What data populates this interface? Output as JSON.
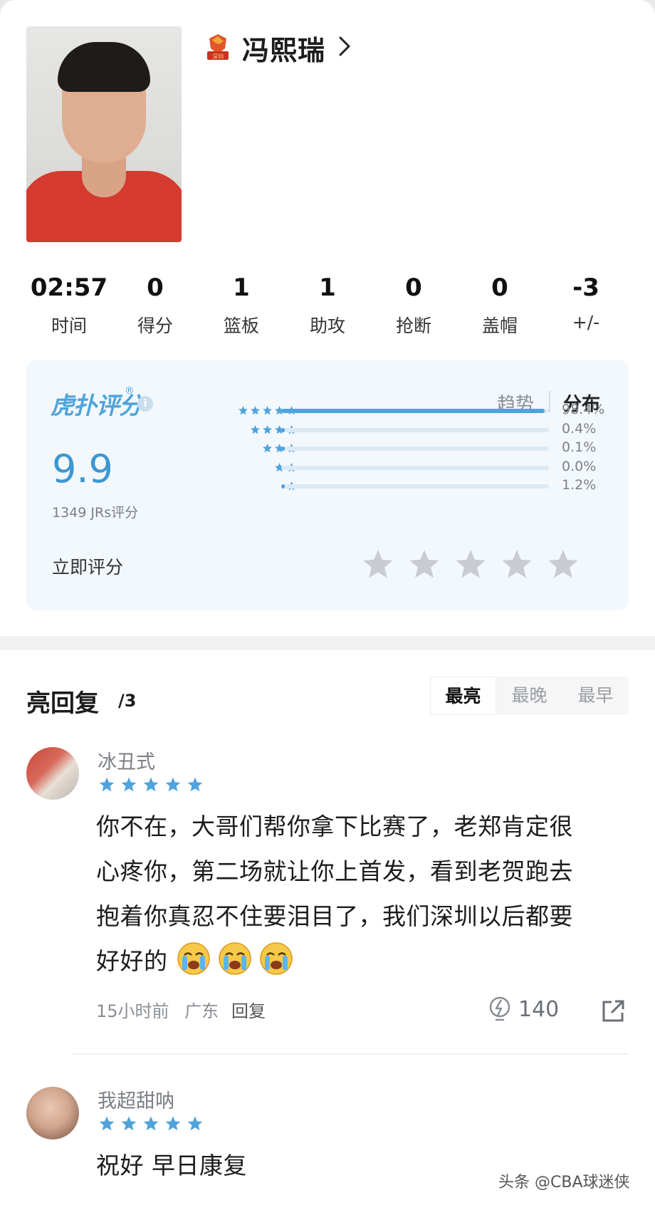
{
  "player": {
    "name": "冯熙瑞",
    "team_logo_text": "深圳"
  },
  "stats": [
    {
      "value": "02:57",
      "label": "时间"
    },
    {
      "value": "0",
      "label": "得分"
    },
    {
      "value": "1",
      "label": "篮板"
    },
    {
      "value": "1",
      "label": "助攻"
    },
    {
      "value": "0",
      "label": "抢断"
    },
    {
      "value": "0",
      "label": "盖帽"
    },
    {
      "value": "-3",
      "label": "+/-"
    }
  ],
  "rating": {
    "brand": "虎扑评分",
    "brand_mark": "®",
    "info_symbol": "i",
    "tabs": {
      "trend": "趋势",
      "distribution": "分布"
    },
    "score": "9.9",
    "votes": "1349 JRs评分",
    "distribution": [
      {
        "stars": 5,
        "percent": "98.4%",
        "fraction": 0.984
      },
      {
        "stars": 4,
        "percent": "0.4%",
        "fraction": 0.004
      },
      {
        "stars": 3,
        "percent": "0.1%",
        "fraction": 0.001
      },
      {
        "stars": 2,
        "percent": "0.0%",
        "fraction": 0.0
      },
      {
        "stars": 1,
        "percent": "1.2%",
        "fraction": 0.012
      }
    ],
    "rate_now": "立即评分",
    "accent": "#4ea3dc"
  },
  "replies": {
    "title": "亮回复",
    "count": "/3",
    "sort_tabs": [
      "最亮",
      "最晚",
      "最早"
    ],
    "active_sort": "最亮"
  },
  "comments": [
    {
      "username": "冰丑式",
      "stars": 5,
      "lines": [
        "你不在，大哥们帮你拿下比赛了，老郑肯定很",
        "心疼你，第二场就让你上首发，看到老贺跑去",
        "抱着你真忍不住要泪目了，我们深圳以后都要",
        "好好的"
      ],
      "emojis": [
        "crying-face",
        "crying-face",
        "crying-face"
      ],
      "time": "15小时前",
      "location": "广东",
      "reply_label": "回复",
      "likes": "140"
    },
    {
      "username": "我超甜呐",
      "stars": 5,
      "lines": [
        "祝好 早日康复"
      ]
    }
  ],
  "watermark": "头条 @CBA球迷侠"
}
